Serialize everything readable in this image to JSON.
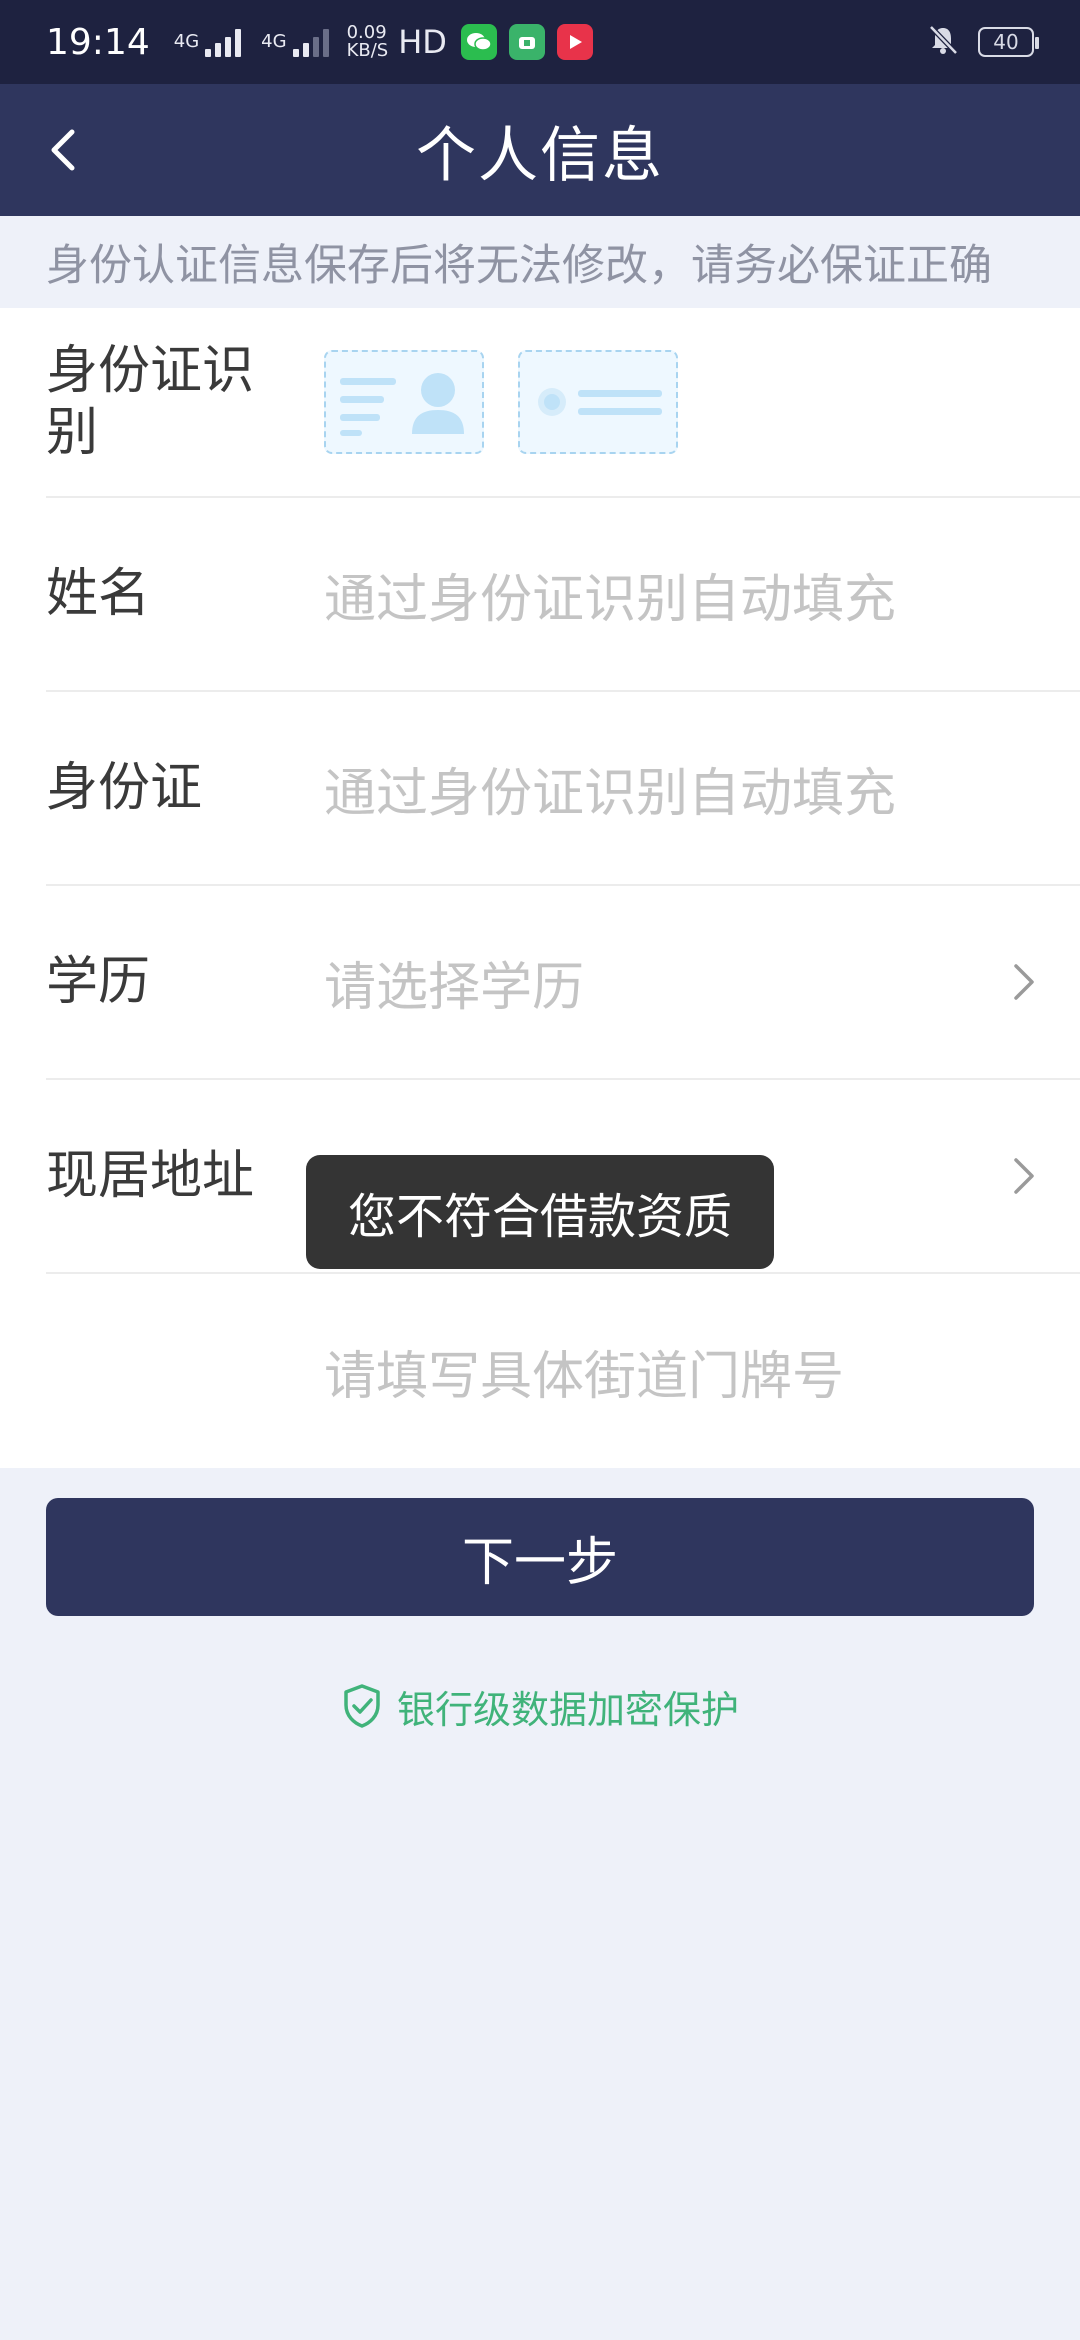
{
  "status_bar": {
    "time": "19:14",
    "net1": "4G",
    "net2": "4G",
    "speed_top": "0.09",
    "speed_bottom": "KB/S",
    "hd": "HD",
    "battery": "40"
  },
  "header": {
    "title": "个人信息"
  },
  "notice": "身份认证信息保存后将无法修改，请务必保证正确",
  "form": {
    "id_recognition_label": "身份证识别",
    "name_label": "姓名",
    "name_placeholder": "通过身份证识别自动填充",
    "id_label": "身份证",
    "id_placeholder": "通过身份证识别自动填充",
    "education_label": "学历",
    "education_placeholder": "请选择学历",
    "address_label": "现居地址",
    "street_placeholder": "请填写具体街道门牌号"
  },
  "next_button": "下一步",
  "secure_text": "银行级数据加密保护",
  "toast": "您不符合借款资质",
  "colors": {
    "header": "#2f365e",
    "accent_green": "#40b37a"
  }
}
